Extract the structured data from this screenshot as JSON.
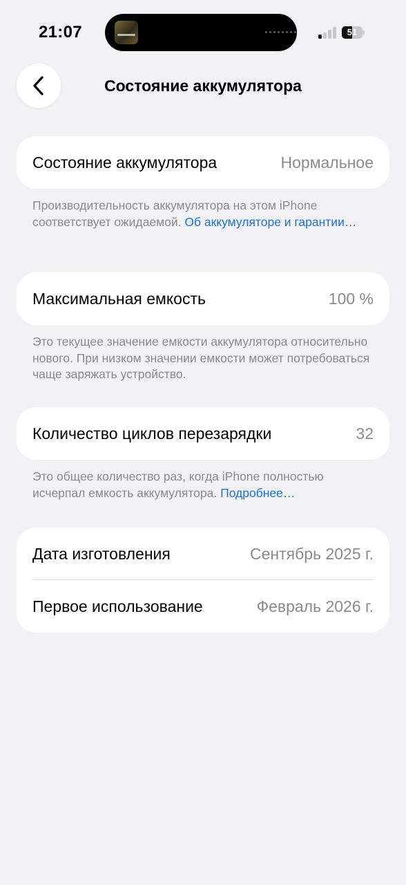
{
  "status_bar": {
    "time": "21:07",
    "battery_level": "51",
    "battery_fraction": 0.51,
    "signal_bars_active": 1,
    "signal_bars_total": 4
  },
  "nav": {
    "back_icon": "chevron-left-icon",
    "title": "Состояние аккумулятора"
  },
  "battery_health": {
    "label": "Состояние аккумулятора",
    "value": "Нормальное",
    "footnote_text": "Производительность аккумулятора на этом iPhone соответствует ожидаемой.",
    "footnote_link": "Об аккумуляторе и гарантии…"
  },
  "max_capacity": {
    "label": "Максимальная емкость",
    "value": "100 %",
    "footnote_text": "Это текущее значение емкости аккумулятора относительно нового. При низком значении емкости может потребоваться чаще заряжать устройство."
  },
  "cycle_count": {
    "label": "Количество циклов перезарядки",
    "value": "32",
    "footnote_text": "Это общее количество раз, когда iPhone полностью исчерпал емкость аккумулятора.",
    "footnote_link": "Подробнее…"
  },
  "dates": {
    "manufacture_label": "Дата изготовления",
    "manufacture_value": "Сентябрь 2025 г.",
    "first_use_label": "Первое использование",
    "first_use_value": "Февраль 2026 г."
  },
  "colors": {
    "background": "#f2f1f6",
    "card": "#ffffff",
    "secondary_text": "#8a8a8e",
    "link": "#1a73d9"
  }
}
